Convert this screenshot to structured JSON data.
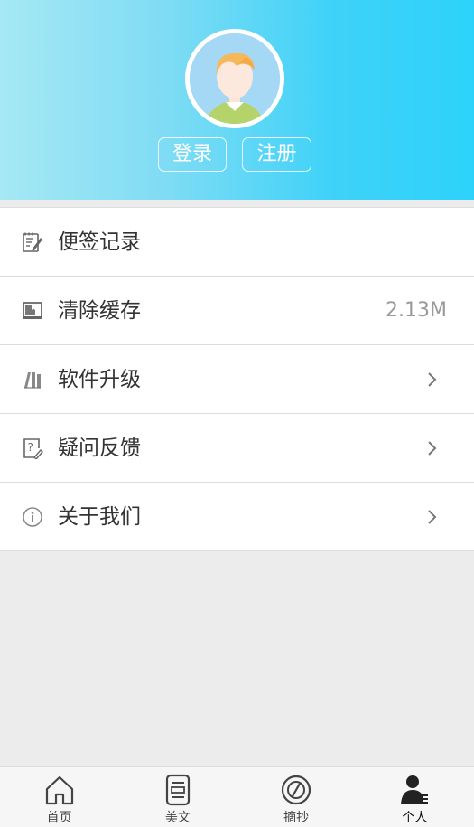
{
  "header": {
    "login_label": "登录",
    "register_label": "注册",
    "gradient_start": "#a6e8f4",
    "gradient_end": "#2dd2fb"
  },
  "menu": {
    "items": [
      {
        "label": "便签记录",
        "icon": "notepad-edit-icon"
      },
      {
        "label": "清除缓存",
        "icon": "book-icon",
        "value": "2.13M"
      },
      {
        "label": "软件升级",
        "icon": "upgrade-books-icon",
        "arrow": true
      },
      {
        "label": "疑问反馈",
        "icon": "question-feedback-icon",
        "arrow": true
      },
      {
        "label": "关于我们",
        "icon": "info-circle-icon",
        "arrow": true
      }
    ]
  },
  "tabbar": {
    "items": [
      {
        "label": "首页",
        "icon": "home-icon"
      },
      {
        "label": "美文",
        "icon": "article-icon"
      },
      {
        "label": "摘抄",
        "icon": "compass-icon"
      },
      {
        "label": "个人",
        "icon": "person-icon",
        "active": true
      }
    ]
  }
}
